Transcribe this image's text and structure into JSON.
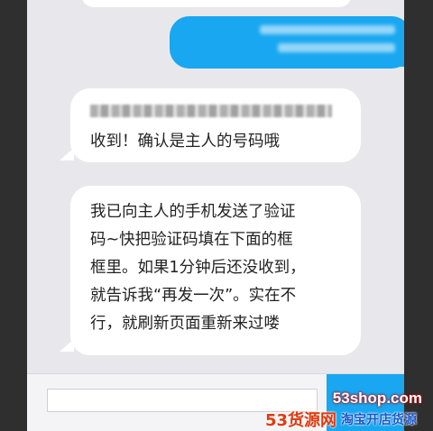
{
  "conversation": {
    "received_1": {
      "text": "收到！确认是主人的号码哦"
    },
    "received_2": {
      "lines": [
        "我已向主人的手机发送了验证",
        "码~快把验证码填在下面的框",
        "框里。如果1分钟后还没收到，",
        "就告诉我“再发一次”。实在不",
        "行，就刷新页面重新来过喽"
      ]
    }
  },
  "input_bar": {
    "placeholder": "",
    "send_label": ""
  },
  "watermark": {
    "site": "53shop.com",
    "brand": "53货源网",
    "slogan": "淘宝开店货源"
  },
  "colors": {
    "bubble_outgoing": "#18a7f0",
    "bubble_incoming": "#ffffff",
    "background": "#e8e8ec"
  }
}
